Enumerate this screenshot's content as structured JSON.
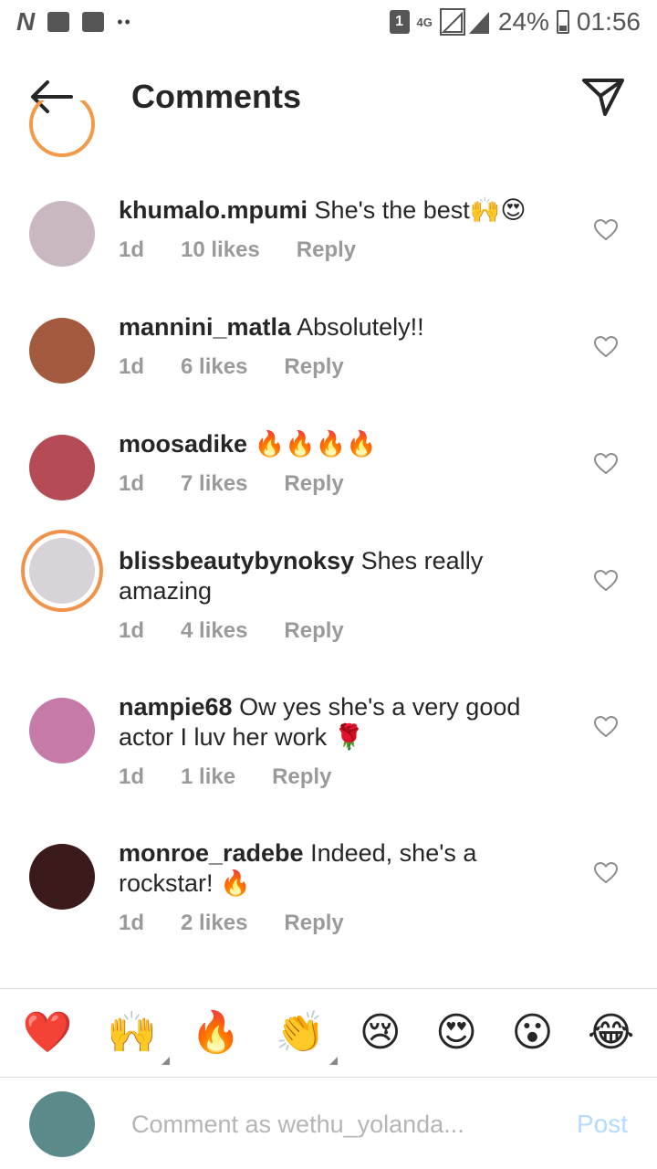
{
  "status_bar": {
    "sim_badge": "1",
    "network": "4G",
    "battery": "24%",
    "time": "01:56",
    "icons": [
      "n-icon",
      "image-icon",
      "folder-icon",
      "dots-icon",
      "sim-icon",
      "network-4g-icon",
      "signal-icon",
      "battery-icon"
    ]
  },
  "header": {
    "title": "Comments",
    "back_icon": "arrow-left-icon",
    "send_icon": "paper-plane-icon"
  },
  "comments": [
    {
      "user": "khumalo.mpumi",
      "text": "She's the best🙌😍",
      "age": "1d",
      "likes": "10 likes",
      "reply": "Reply",
      "avatar_color": "#c9b7c2"
    },
    {
      "user": "mannini_matla",
      "text": "Absolutely!!",
      "age": "1d",
      "likes": "6 likes",
      "reply": "Reply",
      "avatar_color": "#a45a3e"
    },
    {
      "user": "moosadike",
      "text": "🔥🔥🔥🔥",
      "age": "1d",
      "likes": "7 likes",
      "reply": "Reply",
      "avatar_color": "#b54b55"
    },
    {
      "user": "blissbeautybynoksy",
      "text": "Shes really amazing",
      "age": "1d",
      "likes": "4 likes",
      "reply": "Reply",
      "avatar_color": "#d7d3d9"
    },
    {
      "user": "nampie68",
      "text": "Ow yes she's a very good actor I luv her work 🌹",
      "age": "1d",
      "likes": "1 like",
      "reply": "Reply",
      "avatar_color": "#c57aa7"
    },
    {
      "user": "monroe_radebe",
      "text": "Indeed, she's a rockstar! 🔥",
      "age": "1d",
      "likes": "2 likes",
      "reply": "Reply",
      "avatar_color": "#3a1a1a"
    }
  ],
  "emoji_bar": [
    {
      "char": "❤️",
      "name": "red-heart-emoji",
      "has_tones": false
    },
    {
      "char": "🙌",
      "name": "raised-hands-emoji",
      "has_tones": true
    },
    {
      "char": "🔥",
      "name": "fire-emoji",
      "has_tones": false
    },
    {
      "char": "👏",
      "name": "clapping-hands-emoji",
      "has_tones": true
    },
    {
      "char": "😢",
      "name": "crying-face-emoji",
      "has_tones": false
    },
    {
      "char": "😍",
      "name": "heart-eyes-emoji",
      "has_tones": false
    },
    {
      "char": "😮",
      "name": "surprised-face-emoji",
      "has_tones": false
    },
    {
      "char": "😂",
      "name": "tears-of-joy-emoji",
      "has_tones": false
    }
  ],
  "composer": {
    "placeholder": "Comment as wethu_yolanda...",
    "post_label": "Post",
    "avatar_color": "#5b8a8a"
  },
  "colors": {
    "text": "#262626",
    "meta": "#9a9a9a",
    "post_disabled": "#b3dbff",
    "story_ring": "#f0924a"
  }
}
